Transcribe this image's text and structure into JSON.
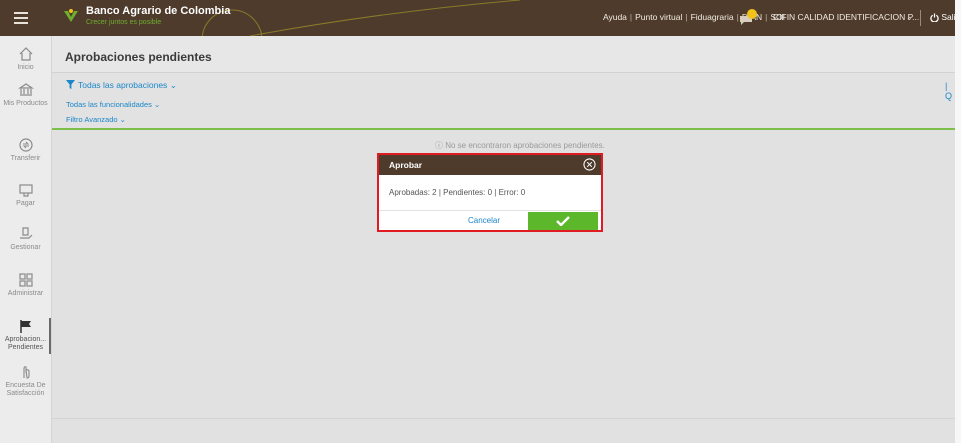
{
  "topbar": {
    "brand_name": "Banco Agrario de Colombia",
    "brand_slogan": "Crecer juntos es posible",
    "links": [
      "Ayuda",
      "Punto virtual",
      "Fiduagraria",
      "DIAN",
      "SOI"
    ],
    "company": "CIFIN CALIDAD IDENTIFICACION P...",
    "logout_label": "Salir",
    "colors": {
      "bar": "#4e3b2c",
      "brand_green": "#6fae2f"
    }
  },
  "sidebar": {
    "items": [
      {
        "label": "Inicio",
        "icon": "home-icon"
      },
      {
        "label": "Mis Productos",
        "icon": "bank-icon"
      },
      {
        "label": "Transferir",
        "icon": "transfer-icon"
      },
      {
        "label": "Pagar",
        "icon": "payment-icon"
      },
      {
        "label": "Gestionar",
        "icon": "hand-coin-icon"
      },
      {
        "label": "Administrar",
        "icon": "grid-icon"
      },
      {
        "label": "Aprobacion... Pendientes",
        "icon": "flag-icon",
        "active": true
      },
      {
        "label": "Encuesta De Satisfacción",
        "icon": "survey-icon"
      }
    ]
  },
  "main": {
    "title": "Aprobaciones pendientes",
    "filter_main": "Todas las aprobaciones",
    "filter_sub": "Todas las funcionalidades",
    "filter_advanced": "Filtro Avanzado",
    "empty_message": "No se encontraron aprobaciones pendientes."
  },
  "modal": {
    "title": "Aprobar",
    "summary": "Aprobadas: 2 | Pendientes: 0 | Error: 0",
    "cancel_label": "Cancelar",
    "confirm_color": "#5cb82a",
    "highlight_color": "#e11b22"
  }
}
